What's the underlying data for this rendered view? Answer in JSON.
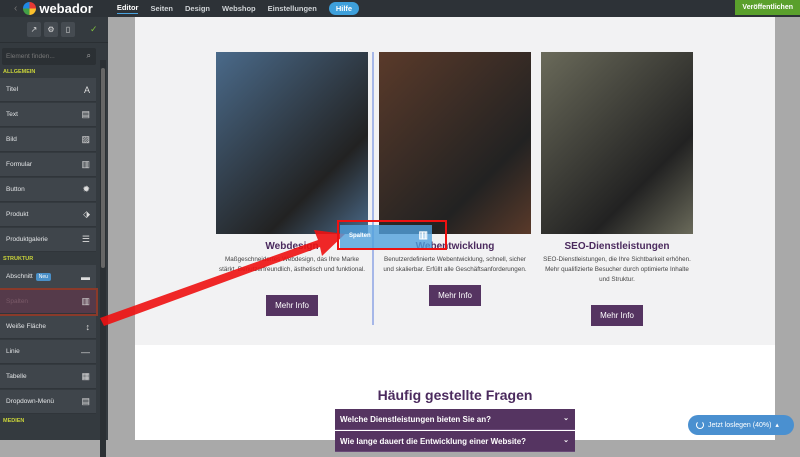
{
  "topbar": {
    "brand": "webador",
    "nav": [
      "Editor",
      "Seiten",
      "Design",
      "Webshop",
      "Einstellungen"
    ],
    "help": "Hilfe",
    "publish": "Veröffentlichen"
  },
  "sidebar": {
    "search_placeholder": "Element finden...",
    "section_general": "ALLGEMEIN",
    "general": [
      {
        "label": "Titel",
        "icon": "A"
      },
      {
        "label": "Text",
        "icon": "▤"
      },
      {
        "label": "Bild",
        "icon": "▨"
      },
      {
        "label": "Formular",
        "icon": "▥"
      },
      {
        "label": "Button",
        "icon": "✹"
      },
      {
        "label": "Produkt",
        "icon": "⬗"
      },
      {
        "label": "Produktgalerie",
        "icon": "☰"
      }
    ],
    "section_structure": "STRUKTUR",
    "structure": [
      {
        "label": "Abschnitt",
        "badge": "Neu",
        "icon": "▬"
      },
      {
        "label": "Spalten",
        "icon": "▥"
      },
      {
        "label": "Weiße Fläche",
        "icon": "↕"
      },
      {
        "label": "Linie",
        "icon": "—"
      },
      {
        "label": "Tabelle",
        "icon": "▦"
      },
      {
        "label": "Dropdown-Menü",
        "icon": "▤"
      }
    ],
    "section_media": "MEDIEN"
  },
  "cards": [
    {
      "title": "Webdesign",
      "text": "Maßgeschneidertes Webdesign, das Ihre Marke stärkt. Benutzerfreundlich, ästhetisch und funktional.",
      "button": "Mehr Info",
      "color": "#4a6a8a"
    },
    {
      "title": "Webentwicklung",
      "text": "Benutzerdefinierte Webentwicklung, schnell, sicher und skalierbar. Erfüllt alle Geschäftsanforderungen.",
      "button": "Mehr Info",
      "color": "#5a3a2a"
    },
    {
      "title": "SEO-Dienstleistungen",
      "text": "SEO-Dienstleistungen, die Ihre Sichtbarkeit erhöhen. Mehr qualifizierte Besucher durch optimierte Inhalte und Struktur.",
      "button": "Mehr Info",
      "color": "#6a6a5a"
    }
  ],
  "drag_label": "Spalten",
  "faq": {
    "title": "Häufig gestellte Fragen",
    "questions": [
      "Welche Dienstleistungen bieten Sie an?",
      "Wie lange dauert die Entwicklung einer Website?"
    ]
  },
  "cta": "Jetzt loslegen (40%)"
}
